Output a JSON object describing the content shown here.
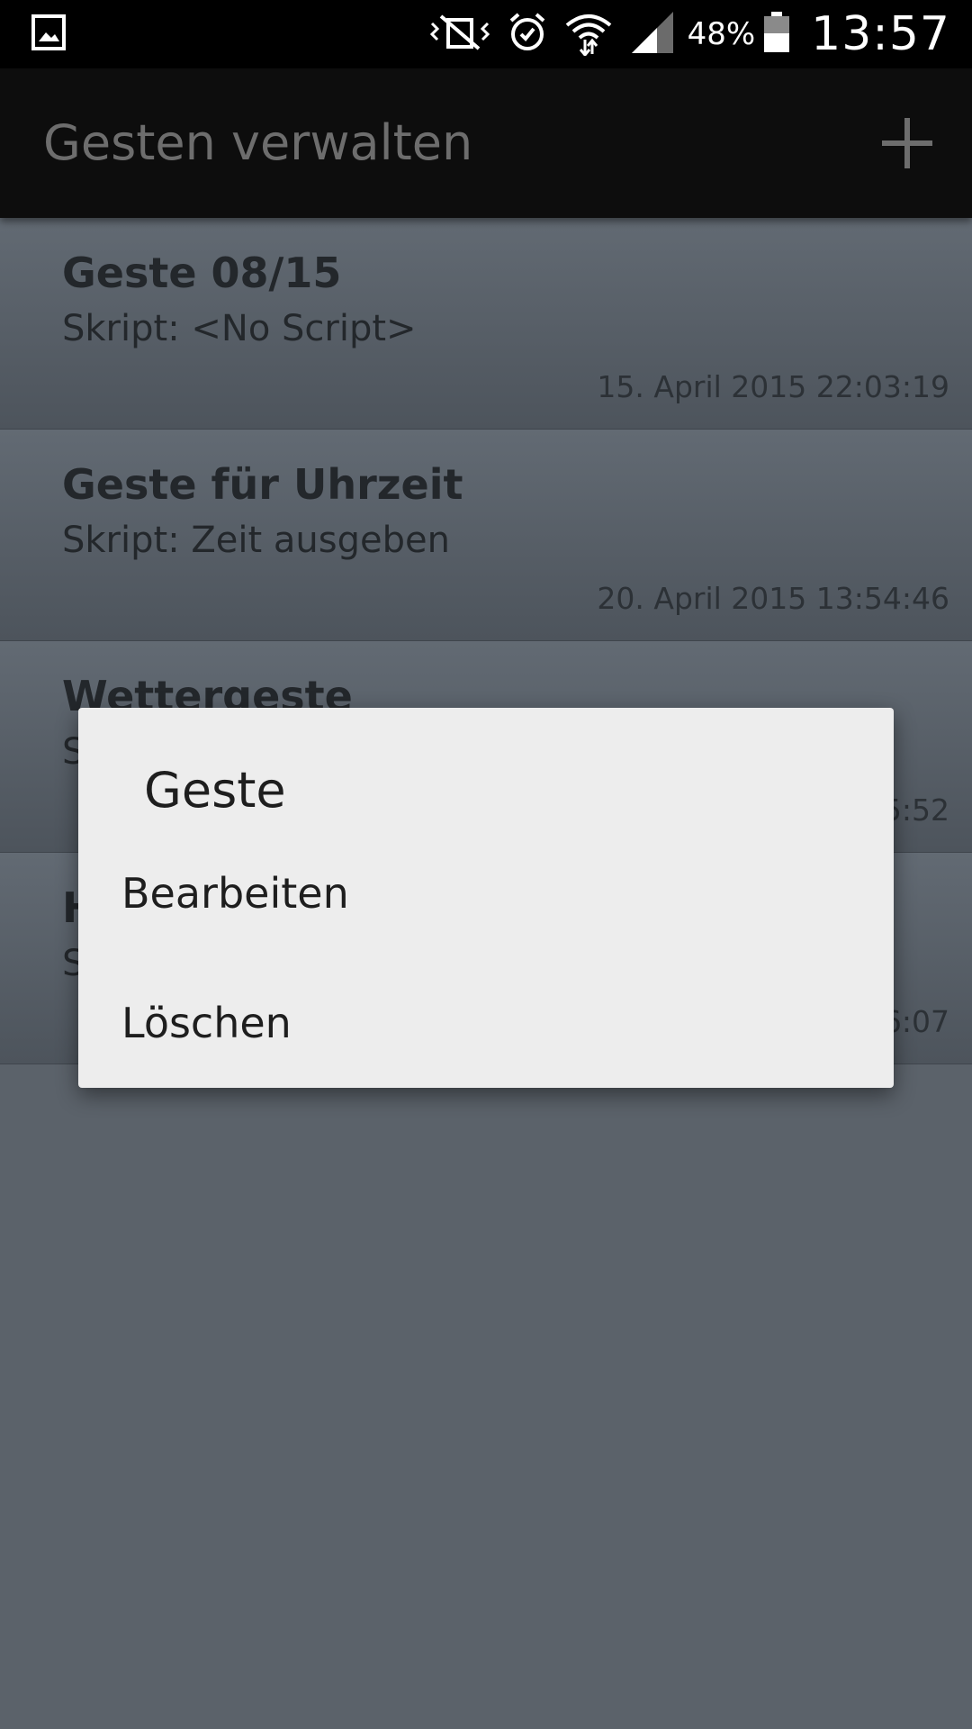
{
  "status_bar": {
    "battery_percent": "48%",
    "time": "13:57",
    "icons": [
      "gallery-icon",
      "vibrate-off-icon",
      "alarm-icon",
      "wifi-icon",
      "signal-icon",
      "battery-icon"
    ]
  },
  "action_bar": {
    "title": "Gesten verwalten",
    "add_icon": "plus-icon"
  },
  "gestures": [
    {
      "title": "Geste 08/15",
      "script": "Skript: <No Script>",
      "date": "15. April 2015 22:03:19"
    },
    {
      "title": "Geste für Uhrzeit",
      "script": "Skript: Zeit ausgeben",
      "date": "20. April 2015 13:54:46"
    },
    {
      "title": "Wettergeste",
      "script": "S",
      "date": "5:52"
    },
    {
      "title": "H",
      "script": "S",
      "date": "6:07"
    }
  ],
  "dialog": {
    "title": "Geste",
    "options": [
      "Bearbeiten",
      "Löschen"
    ]
  },
  "colors": {
    "status_bar": "#000000",
    "action_bar": "#0d0d0d",
    "list_bg": "#5b626a",
    "dialog_bg": "#ededed",
    "title_text": "#6d6d6d"
  }
}
